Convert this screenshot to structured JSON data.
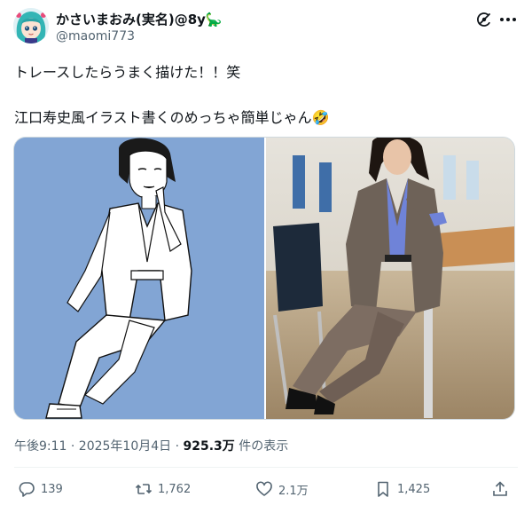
{
  "author": {
    "display_name": "かさいまおみ(実名)@8y🦕",
    "handle": "@maomi773"
  },
  "tweet": {
    "line1": "トレースしたらうまく描けた！！笑",
    "line2": "江口寿史風イラスト書くのめっちゃ簡単じゃん🤣"
  },
  "meta": {
    "timestamp": "午後9:11 · 2025年10月4日 · ",
    "views_count": "925.3万",
    "views_label": " 件の表示"
  },
  "actions": {
    "replies": "139",
    "retweets": "1,762",
    "likes": "2.1万",
    "bookmarks": "1,425"
  },
  "icons": [
    "grok-icon",
    "more-icon",
    "reply-icon",
    "retweet-icon",
    "like-icon",
    "bookmark-icon",
    "share-icon"
  ],
  "colors": {
    "text": "#0f1419",
    "secondary": "#536471",
    "illustration_bg": "#82a5d4",
    "border": "#cfd9de"
  }
}
